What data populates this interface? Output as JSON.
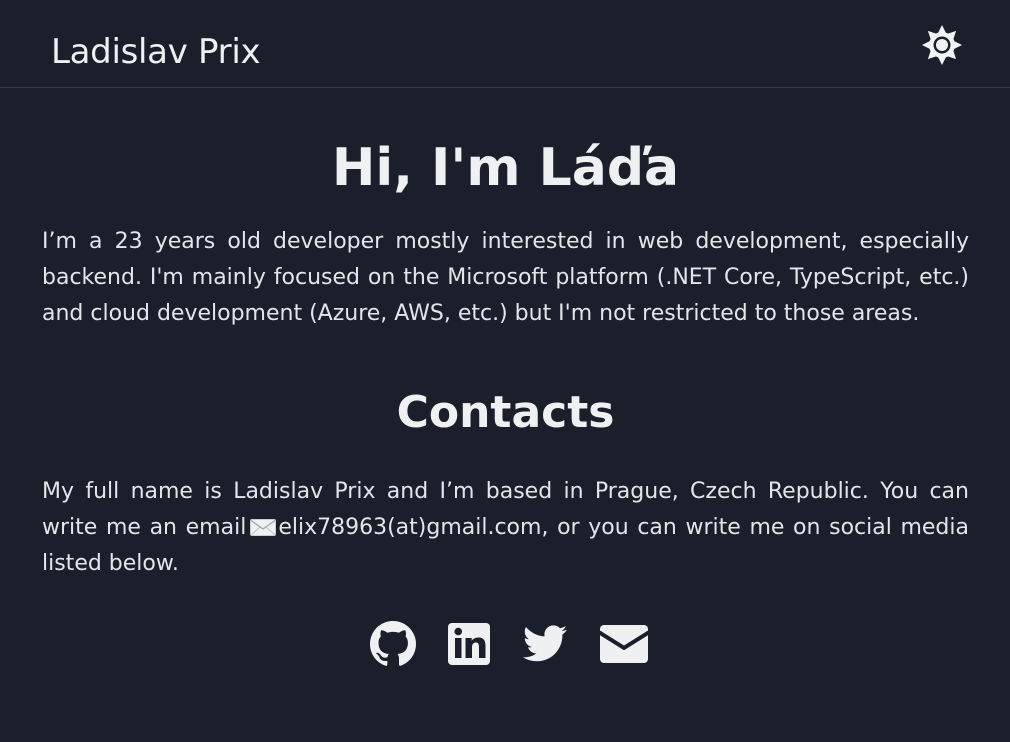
{
  "header": {
    "site_title": "Ladislav Prix",
    "theme_toggle_icon": "sun-icon"
  },
  "hero": {
    "title": "Hi, I'm Láďa",
    "intro": "I’m a 23 years old developer mostly interested in web development, especially backend. I'm mainly focused on the Microsoft platform (.NET Core, TypeScript, etc.) and cloud development (Azure, AWS, etc.) but I'm not restricted to those areas."
  },
  "contacts": {
    "title": "Contacts",
    "text_before_email": "My full name is Ladislav Prix and I’m based in Prague, Czech Republic. You can write me an email",
    "email_icon": "envelope-emoji-icon",
    "email": "elix78963(at)gmail.com",
    "text_after_email": ", or you can write me on social media listed below."
  },
  "social": [
    {
      "icon": "github-icon"
    },
    {
      "icon": "linkedin-icon"
    },
    {
      "icon": "twitter-icon"
    },
    {
      "icon": "email-icon"
    }
  ],
  "colors": {
    "background": "#1b1f2c",
    "text": "#e8e9ec",
    "divider": "#33394a"
  }
}
